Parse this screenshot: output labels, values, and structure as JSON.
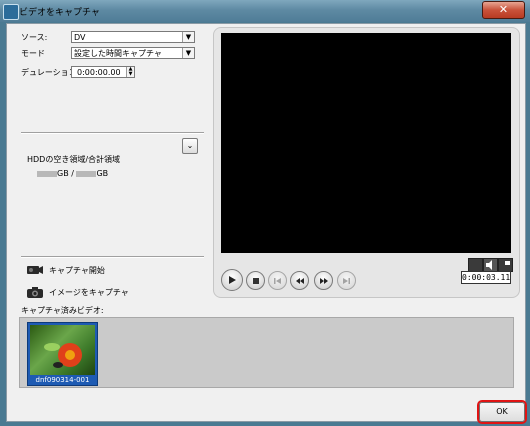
{
  "window": {
    "title": "ビデオをキャプチャ",
    "close_label": "✕"
  },
  "settings": {
    "source_label": "ソース:",
    "source_value": "DV",
    "mode_label": "モード",
    "mode_value": "設定した時間キャプチャ",
    "duration_label": "デュレーション:",
    "duration_value": "0:00:00.00"
  },
  "disk": {
    "label": "HDDの空き領域/合計領域",
    "free_value": "GB",
    "separator": " / ",
    "total_value": "GB"
  },
  "actions": {
    "start_capture": "キャプチャ開始",
    "capture_image": "イメージをキャプチャ"
  },
  "player": {
    "timecode": "0:00:03.11"
  },
  "captured": {
    "label": "キャプチャ済みビデオ:",
    "items": [
      {
        "name": "dnf090314-001"
      }
    ]
  },
  "footer": {
    "ok_label": "OK"
  }
}
